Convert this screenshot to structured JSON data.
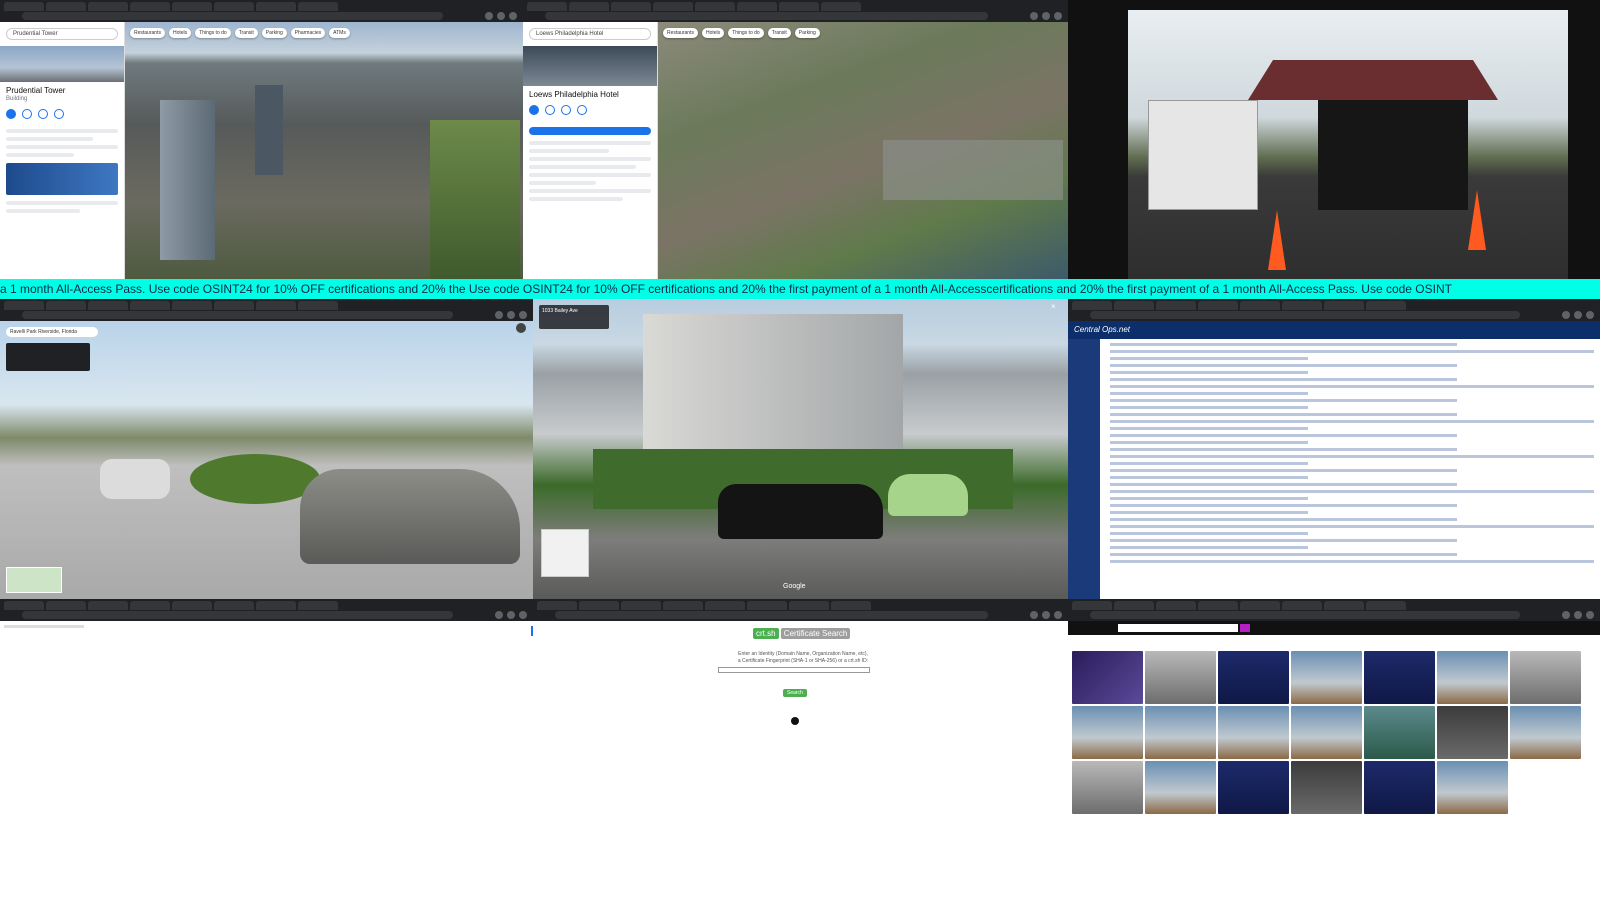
{
  "banner": {
    "text": "a 1 month All-Access Pass.          Use code OSINT24 for 10% OFF certifications and 20% the          Use code OSINT24 for 10% OFF certifications and 20% the first payment of a 1 month All-Accesscertifications and 20% the first payment of a 1 month All-Access Pass.          Use code OSINT"
  },
  "maps1": {
    "search": "Prudential Tower",
    "title": "Prudential Tower",
    "subtitle": "Building",
    "chips": [
      "Restaurants",
      "Hotels",
      "Things to do",
      "Transit",
      "Parking",
      "Pharmacies",
      "ATMs"
    ]
  },
  "maps2": {
    "search": "Loews Philadelphia Hotel",
    "title": "Loews Philadelphia Hotel",
    "chips": [
      "Restaurants",
      "Hotels",
      "Things to do",
      "Transit",
      "Parking"
    ]
  },
  "street1": {
    "search": "Ravelli Park Riverside, Florida"
  },
  "street2": {
    "address": "1033 Bailey Ave",
    "watermark": "Google"
  },
  "ops": {
    "brand": "Central Ops.net"
  },
  "crt": {
    "logo_a": "crt.sh",
    "logo_b": "Certificate Search",
    "line1": "Enter an Identity (Domain Name, Organization Name, etc),",
    "line2": "a Certificate Fingerprint (SHA-1 or SHA-256) or a crt.sh ID:",
    "button": "Search"
  },
  "colors": {
    "banner": "#00ffe7",
    "chrome": "#202124",
    "maps_blue": "#1a73e8",
    "ops_navy": "#0c2e6a",
    "crt_green": "#4caf50",
    "search_purple": "#b51fc4"
  }
}
